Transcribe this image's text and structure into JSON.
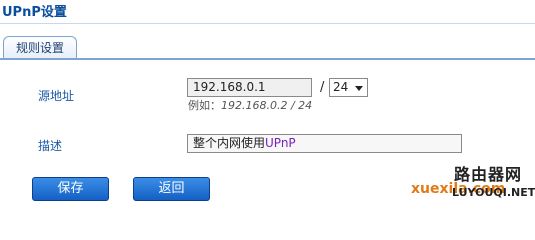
{
  "page": {
    "title": "UPnP设置"
  },
  "tabs": [
    {
      "label": "规则设置",
      "active": true
    }
  ],
  "form": {
    "source_address": {
      "label": "源地址",
      "value": "192.168.0.1",
      "separator": "/",
      "mask_value": "24",
      "hint_prefix": "例如：",
      "hint_example": "192.168.0.2 / 24"
    },
    "description": {
      "label": "描述",
      "value_prefix": "整个内网使用",
      "value_highlight": "UPnP"
    }
  },
  "buttons": {
    "save": "保存",
    "back": "返回"
  },
  "watermark": {
    "cn": "路由器网",
    "url_colored": "xuexila.com",
    "url_plain": "LUYOUQI.NET"
  },
  "colors": {
    "title": "#0a4f9c",
    "label": "#1b5aa3",
    "button": "#1f6fd6",
    "highlight": "#7a1fb8",
    "border": "#7fa4d1"
  }
}
